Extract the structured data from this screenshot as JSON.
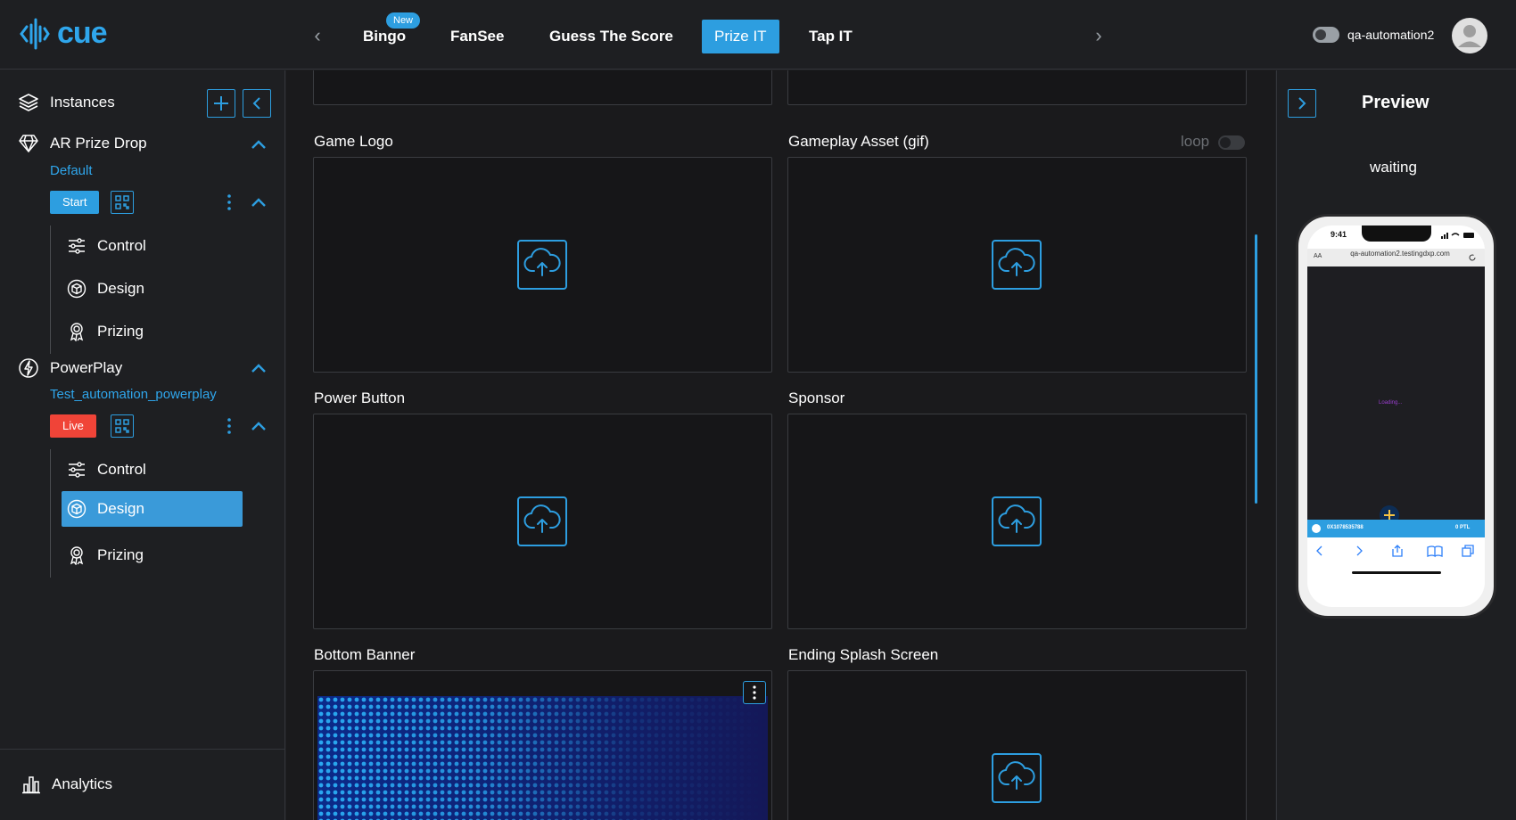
{
  "brand": {
    "name": "cue",
    "accent": "#2d9ee0"
  },
  "topnav": {
    "tabs": [
      {
        "label": "Bingo",
        "badge": "New"
      },
      {
        "label": "FanSee"
      },
      {
        "label": "Guess The Score"
      },
      {
        "label": "Prize IT",
        "active": true
      },
      {
        "label": "Tap IT"
      }
    ],
    "prev_icon": "chevron-left-icon",
    "next_icon": "chevron-right-icon"
  },
  "user": {
    "name": "qa-automation2"
  },
  "sidebar": {
    "header": {
      "label": "Instances"
    },
    "instances": [
      {
        "name": "AR Prize Drop",
        "sub": "Default",
        "status": "Start",
        "status_color": "#2d9ee0",
        "items": [
          "Control",
          "Design",
          "Prizing"
        ]
      },
      {
        "name": "PowerPlay",
        "sub": "Test_automation_powerplay",
        "status": "Live",
        "status_color": "#f04438",
        "items": [
          "Control",
          "Design",
          "Prizing"
        ],
        "active_item": "Design"
      }
    ],
    "footer": {
      "label": "Analytics"
    }
  },
  "main": {
    "sections": [
      {
        "label": "Game Logo"
      },
      {
        "label": "Gameplay Asset (gif)",
        "toggle_label": "loop"
      },
      {
        "label": "Power Button"
      },
      {
        "label": "Sponsor"
      },
      {
        "label": "Bottom Banner"
      },
      {
        "label": "Ending Splash Screen"
      }
    ]
  },
  "preview": {
    "title": "Preview",
    "status": "waiting",
    "phone": {
      "time": "9:41",
      "url_left": "AA",
      "url": "qa-automation2.testingdxp.com",
      "loading": "Loading...",
      "bottom_left": "0X1078535788",
      "bottom_right": "0 PTL"
    }
  }
}
